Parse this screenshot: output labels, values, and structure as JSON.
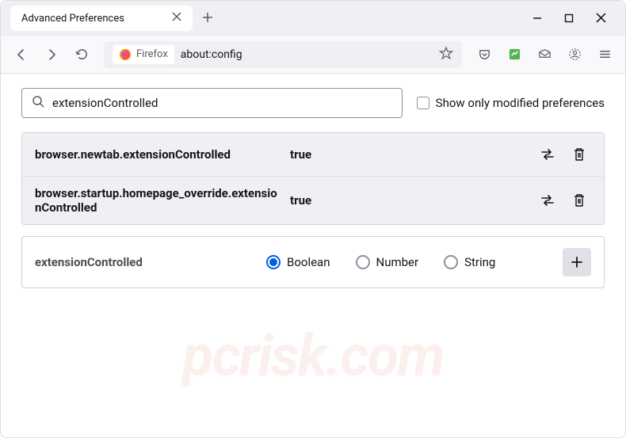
{
  "window": {
    "tab_title": "Advanced Preferences"
  },
  "urlbar": {
    "identity_label": "Firefox",
    "url": "about:config"
  },
  "search": {
    "value": "extensionControlled",
    "checkbox_label": "Show only modified preferences"
  },
  "prefs": [
    {
      "name": "browser.newtab.extensionControlled",
      "value": "true"
    },
    {
      "name": "browser.startup.homepage_override.extensionControlled",
      "value": "true"
    }
  ],
  "newpref": {
    "name": "extensionControlled",
    "types": [
      "Boolean",
      "Number",
      "String"
    ],
    "selected": "Boolean"
  },
  "watermark": "pcrisk.com"
}
